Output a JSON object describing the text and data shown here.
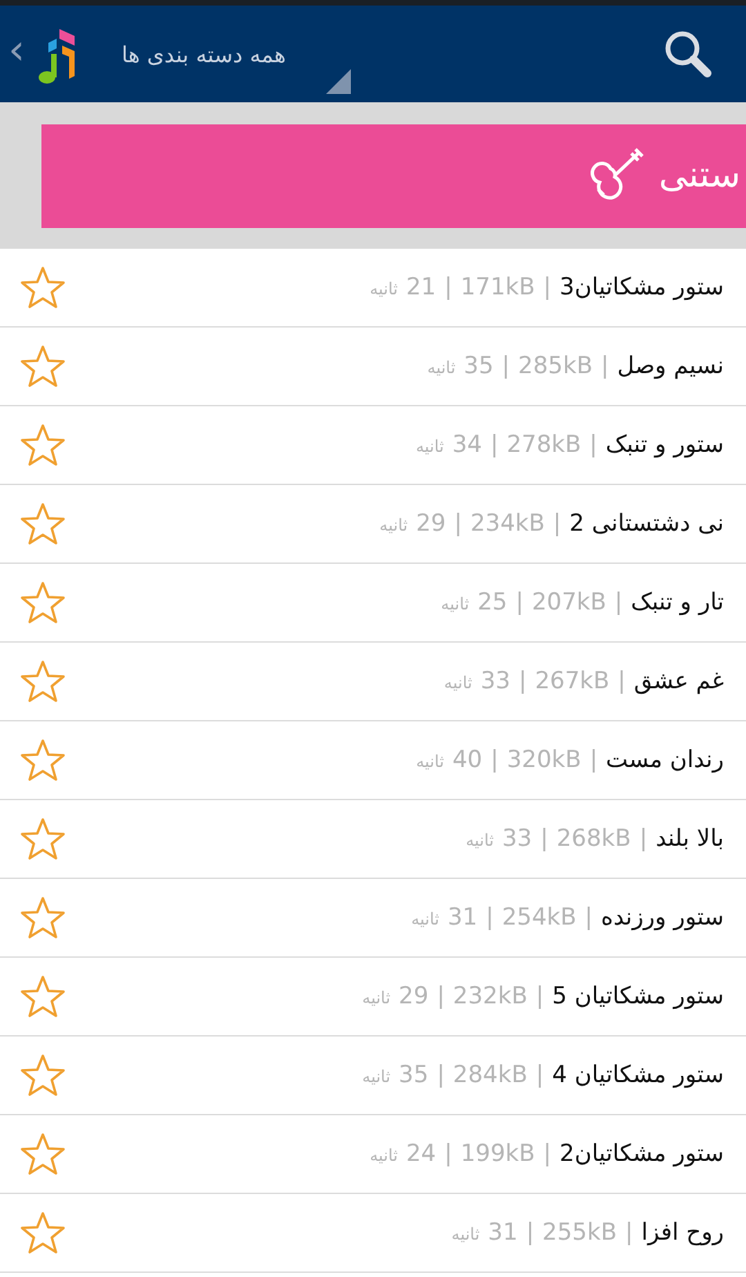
{
  "header": {
    "back": "‹",
    "category_menu": "همه دسته بندی ها"
  },
  "category": {
    "title": "ستنی"
  },
  "separator": "|",
  "tracks": [
    {
      "title": "ستور مشکاتیان3",
      "size": "171kB",
      "seconds": "21",
      "unit": "ثانیه",
      "favorite": false
    },
    {
      "title": "نسیم وصل",
      "size": "285kB",
      "seconds": "35",
      "unit": "ثانیه",
      "favorite": false
    },
    {
      "title": "ستور و تنبک",
      "size": "278kB",
      "seconds": "34",
      "unit": "ثانیه",
      "favorite": false
    },
    {
      "title": "نی دشتستانی 2",
      "size": "234kB",
      "seconds": "29",
      "unit": "ثانیه",
      "favorite": false
    },
    {
      "title": "تار و تنبک",
      "size": "207kB",
      "seconds": "25",
      "unit": "ثانیه",
      "favorite": false
    },
    {
      "title": "غم عشق",
      "size": "267kB",
      "seconds": "33",
      "unit": "ثانیه",
      "favorite": false
    },
    {
      "title": "رندان مست",
      "size": "320kB",
      "seconds": "40",
      "unit": "ثانیه",
      "favorite": false
    },
    {
      "title": "بالا بلند",
      "size": "268kB",
      "seconds": "33",
      "unit": "ثانیه",
      "favorite": false
    },
    {
      "title": "ستور ورزنده",
      "size": "254kB",
      "seconds": "31",
      "unit": "ثانیه",
      "favorite": false
    },
    {
      "title": "ستور مشکاتیان 5",
      "size": "232kB",
      "seconds": "29",
      "unit": "ثانیه",
      "favorite": false
    },
    {
      "title": "ستور مشکاتیان 4",
      "size": "284kB",
      "seconds": "35",
      "unit": "ثانیه",
      "favorite": false
    },
    {
      "title": "ستور مشکاتیان2",
      "size": "199kB",
      "seconds": "24",
      "unit": "ثانیه",
      "favorite": false
    },
    {
      "title": "روح افزا",
      "size": "255kB",
      "seconds": "31",
      "unit": "ثانیه",
      "favorite": false
    }
  ]
}
